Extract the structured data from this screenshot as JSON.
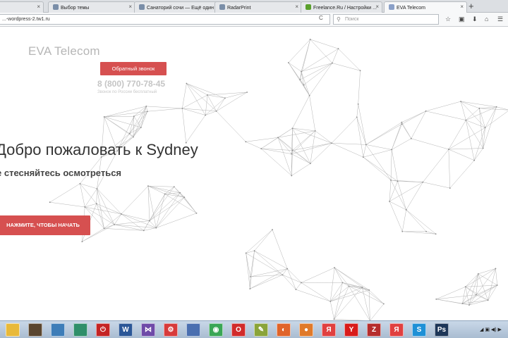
{
  "browser": {
    "tabs": [
      {
        "label": "",
        "favicon_color": "#8a8a8a"
      },
      {
        "label": "Выбор темы",
        "favicon_color": "#7a8ea8"
      },
      {
        "label": "Санаторий сочи — Ещё один с...",
        "favicon_color": "#7a8ea8"
      },
      {
        "label": "RadarPrint",
        "favicon_color": "#7a8ea8"
      },
      {
        "label": "Freelance.Ru / Настройки ...",
        "favicon_color": "#5aa02c"
      },
      {
        "label": "EVA Telecom",
        "favicon_color": "#8aa0c8"
      }
    ],
    "new_tab": "+",
    "close_glyph": "×",
    "url": "...-wordpress-2.tw1.ru",
    "reload_glyph": "C",
    "search_placeholder": "Поиск",
    "search_glyph": "⚲",
    "nav_icons": [
      "☆",
      "▣",
      "⬇",
      "⌂",
      "☰"
    ]
  },
  "page": {
    "brand": "EVA Telecom",
    "callback_button": "Обратный звонок",
    "phone": "8 (800) 770-78-45",
    "phone_note": "Звонок по России бесплатный",
    "hero_title": "Добро пожаловать к Sydney",
    "hero_subtitle": "е стесняйтесь осмотреться",
    "cta_button": "НАЖМИТЕ, ЧТОБЫ НАЧАТЬ"
  },
  "taskbar": {
    "items": [
      {
        "name": "folder-icon",
        "glyph": "",
        "color": "#e8b93a"
      },
      {
        "name": "media-player-icon",
        "glyph": "",
        "color": "#5a4630"
      },
      {
        "name": "photo-icon",
        "glyph": "",
        "color": "#3d7db8"
      },
      {
        "name": "app-green-icon",
        "glyph": "",
        "color": "#2f8f6a"
      },
      {
        "name": "power-icon",
        "glyph": "⏻",
        "color": "#c42424"
      },
      {
        "name": "word-icon",
        "glyph": "W",
        "color": "#2b5797"
      },
      {
        "name": "visual-studio-icon",
        "glyph": "⋈",
        "color": "#6e4aa8"
      },
      {
        "name": "red-app-icon",
        "glyph": "⚙",
        "color": "#d73b3b"
      },
      {
        "name": "save-disk-icon",
        "glyph": "",
        "color": "#4a6fb0"
      },
      {
        "name": "chrome-icon",
        "glyph": "◉",
        "color": "#3aa655"
      },
      {
        "name": "opera-icon",
        "glyph": "O",
        "color": "#d12b2b"
      },
      {
        "name": "notepad-icon",
        "glyph": "✎",
        "color": "#8aa43a"
      },
      {
        "name": "firefox-icon",
        "glyph": "◐",
        "color": "#e0642a"
      },
      {
        "name": "basketball-icon",
        "glyph": "●",
        "color": "#e07a2a"
      },
      {
        "name": "yandex-browser-icon",
        "glyph": "Я",
        "color": "#e04040"
      },
      {
        "name": "yandex-icon",
        "glyph": "Y",
        "color": "#d81b1b"
      },
      {
        "name": "filezilla-icon",
        "glyph": "Z",
        "color": "#b52d2d"
      },
      {
        "name": "yandex-browser-2-icon",
        "glyph": "Я",
        "color": "#e04040"
      },
      {
        "name": "skype-icon",
        "glyph": "S",
        "color": "#1e90d6"
      },
      {
        "name": "photoshop-icon",
        "glyph": "Ps",
        "color": "#1d3658"
      }
    ],
    "tray_text": "◢ ▣ ◀) ▶"
  }
}
